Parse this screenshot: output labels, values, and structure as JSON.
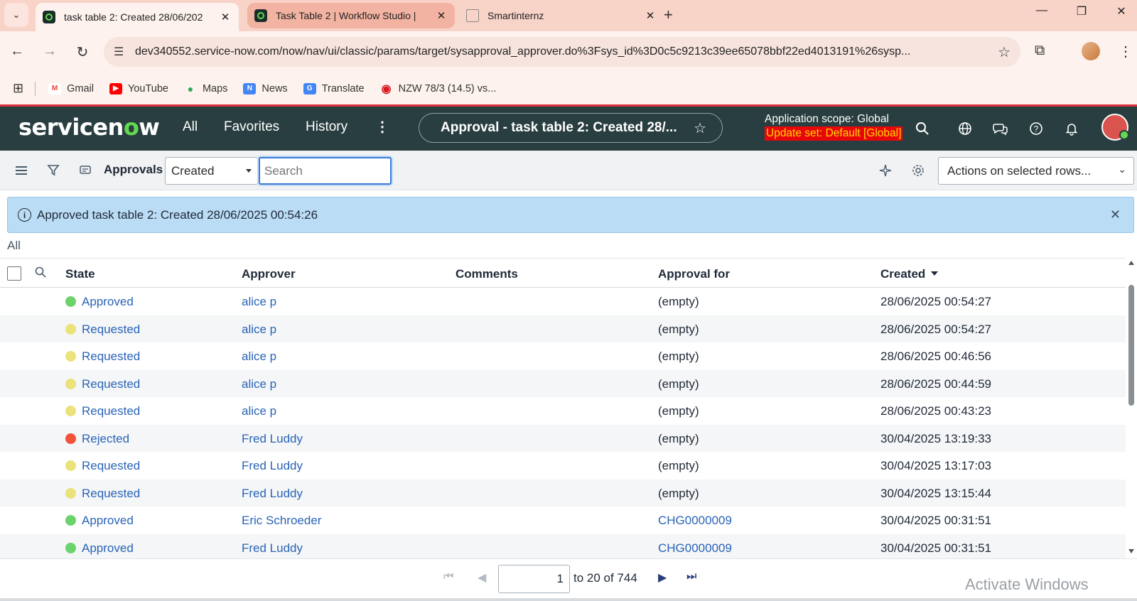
{
  "browser": {
    "tabs": [
      {
        "title": "task table 2: Created 28/06/202",
        "close": "✕"
      },
      {
        "title": "Task Table 2 | Workflow Studio |",
        "close": "✕"
      },
      {
        "title": "Smartinternz",
        "close": "✕"
      }
    ],
    "new_tab": "+",
    "window": {
      "minimize": "—",
      "restore": "❐",
      "close": "✕"
    },
    "url": "dev340552.service-now.com/now/nav/ui/classic/params/target/sysapproval_approver.do%3Fsys_id%3D0c5c9213c39ee65078bbf22ed4013191%26sysp...",
    "bookmarks": [
      {
        "label": "Gmail",
        "color": "#ea4335",
        "glyph": "M"
      },
      {
        "label": "YouTube",
        "color": "#ff0000",
        "glyph": "▶"
      },
      {
        "label": "Maps",
        "color": "#34a853",
        "glyph": "●"
      },
      {
        "label": "News",
        "color": "#4285f4",
        "glyph": "N"
      },
      {
        "label": "Translate",
        "color": "#4285f4",
        "glyph": "G"
      },
      {
        "label": "NZW 78/3 (14.5) vs...",
        "color": "#d71920",
        "glyph": "◉"
      }
    ]
  },
  "sn_header": {
    "logo_pre": "servicen",
    "logo_o": "o",
    "logo_post": "w",
    "nav": [
      "All",
      "Favorites",
      "History"
    ],
    "record_title": "Approval - task table 2: Created 28/...",
    "scope_label": "Application scope: Global",
    "update_set": "Update set: Default [Global]"
  },
  "list": {
    "title": "Approvals",
    "filter_field": "Created",
    "search_placeholder": "Search",
    "actions_label": "Actions on selected rows..."
  },
  "banner": {
    "message": "Approved task table 2: Created 28/06/2025 00:54:26"
  },
  "breadcrumb": "All",
  "table": {
    "columns": [
      "State",
      "Approver",
      "Comments",
      "Approval for",
      "Created"
    ],
    "rows": [
      {
        "state": "Approved",
        "state_color": "#6cd26a",
        "approver": "alice p",
        "comments": "",
        "approval_for": "(empty)",
        "approval_for_link": false,
        "created": "28/06/2025 00:54:27"
      },
      {
        "state": "Requested",
        "state_color": "#ece27a",
        "approver": "alice p",
        "comments": "",
        "approval_for": "(empty)",
        "approval_for_link": false,
        "created": "28/06/2025 00:54:27"
      },
      {
        "state": "Requested",
        "state_color": "#ece27a",
        "approver": "alice p",
        "comments": "",
        "approval_for": "(empty)",
        "approval_for_link": false,
        "created": "28/06/2025 00:46:56"
      },
      {
        "state": "Requested",
        "state_color": "#ece27a",
        "approver": "alice p",
        "comments": "",
        "approval_for": "(empty)",
        "approval_for_link": false,
        "created": "28/06/2025 00:44:59"
      },
      {
        "state": "Requested",
        "state_color": "#ece27a",
        "approver": "alice p",
        "comments": "",
        "approval_for": "(empty)",
        "approval_for_link": false,
        "created": "28/06/2025 00:43:23"
      },
      {
        "state": "Rejected",
        "state_color": "#f0533a",
        "approver": "Fred Luddy",
        "comments": "",
        "approval_for": "(empty)",
        "approval_for_link": false,
        "created": "30/04/2025 13:19:33"
      },
      {
        "state": "Requested",
        "state_color": "#ece27a",
        "approver": "Fred Luddy",
        "comments": "",
        "approval_for": "(empty)",
        "approval_for_link": false,
        "created": "30/04/2025 13:17:03"
      },
      {
        "state": "Requested",
        "state_color": "#ece27a",
        "approver": "Fred Luddy",
        "comments": "",
        "approval_for": "(empty)",
        "approval_for_link": false,
        "created": "30/04/2025 13:15:44"
      },
      {
        "state": "Approved",
        "state_color": "#6cd26a",
        "approver": "Eric Schroeder",
        "comments": "",
        "approval_for": "CHG0000009",
        "approval_for_link": true,
        "created": "30/04/2025 00:31:51"
      },
      {
        "state": "Approved",
        "state_color": "#6cd26a",
        "approver": "Fred Luddy",
        "comments": "",
        "approval_for": "CHG0000009",
        "approval_for_link": true,
        "created": "30/04/2025 00:31:51"
      }
    ]
  },
  "pager": {
    "page_value": "1",
    "range_text": "to 20 of 744"
  },
  "watermark": "Activate Windows",
  "colors": {
    "header_bg": "#293e40",
    "brand_green": "#62d84e",
    "link": "#2a64b7",
    "banner_bg": "#bbdcf5"
  }
}
